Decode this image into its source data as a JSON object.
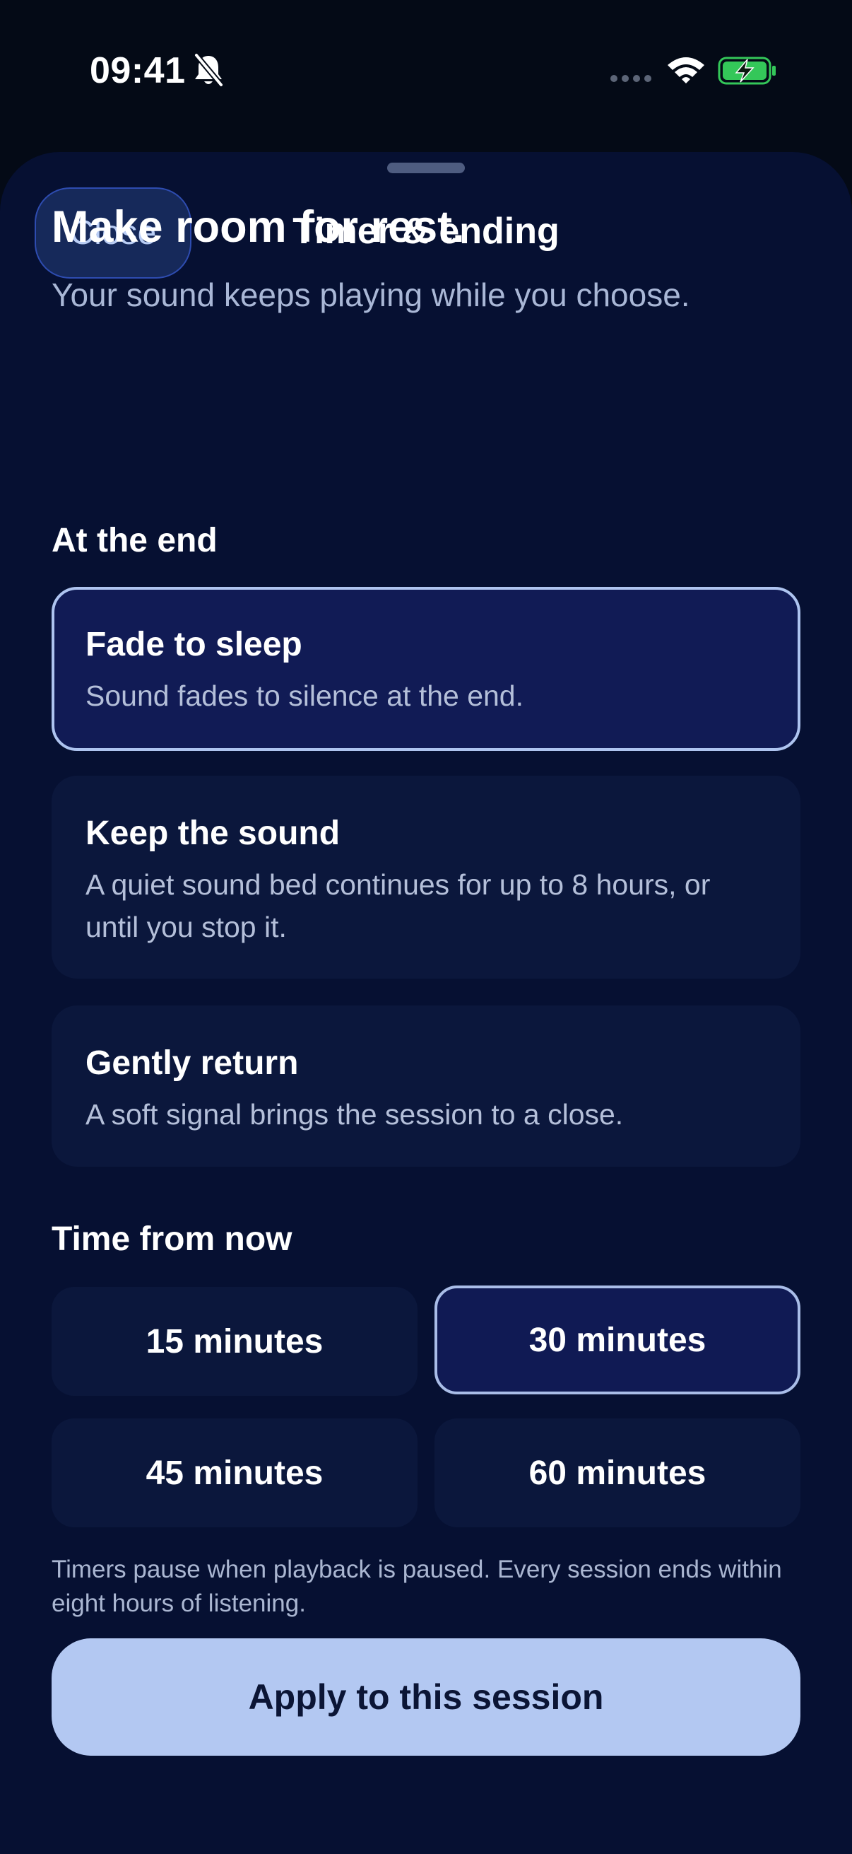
{
  "status_bar": {
    "time": "09:41"
  },
  "icons": {
    "silent": "bell-slash-icon",
    "signal": "cellular-signal-icon",
    "wifi": "wifi-icon",
    "battery": "battery-charging-icon"
  },
  "colors": {
    "background": "#040a16",
    "sheet": "#061032",
    "card": "#0b173c",
    "card_selected": "#111b55",
    "selected_border": "#aec4f0",
    "accent_button": "#b3c8f2",
    "battery_green": "#34c759"
  },
  "header": {
    "close_label": "Close",
    "title": "Timer & ending"
  },
  "intro": {
    "headline": "Make room for rest.",
    "subhead": "Your sound keeps playing while you choose."
  },
  "ending": {
    "section_label": "At the end",
    "selected": "Fade to sleep",
    "options": [
      {
        "title": "Fade to sleep",
        "description": "Sound fades to silence at the end."
      },
      {
        "title": "Keep the sound",
        "description": "A quiet sound bed continues for up to 8 hours, or until you stop it."
      },
      {
        "title": "Gently return",
        "description": "A soft signal brings the session to a close."
      }
    ]
  },
  "timer": {
    "section_label": "Time from now",
    "selected": "30 minutes",
    "options": [
      "15 minutes",
      "30 minutes",
      "45 minutes",
      "60 minutes"
    ]
  },
  "footnote": "Timers pause when playback is paused. Every session ends within eight hours of listening.",
  "apply_label": "Apply to this session"
}
